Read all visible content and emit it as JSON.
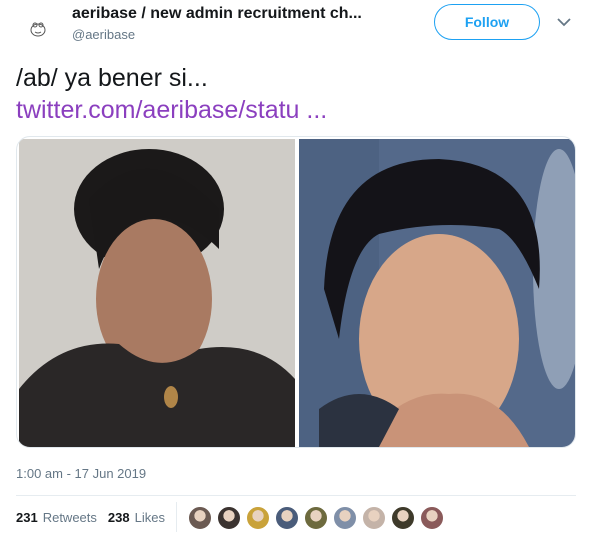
{
  "header": {
    "display_name": "aeribase / new admin recruitment ch...",
    "handle": "@aeribase",
    "follow_label": "Follow",
    "avatar_icon": "frog-doodle-icon",
    "menu_icon": "chevron-down-icon"
  },
  "tweet": {
    "text": "/ab/ ya bener si...",
    "link": "twitter.com/aeribase/statu ...",
    "link_color": "#8b3fbf"
  },
  "media": {
    "photos": [
      {
        "name": "photo-left",
        "icon": "portrait-photo"
      },
      {
        "name": "photo-right",
        "icon": "portrait-photo"
      }
    ]
  },
  "meta": {
    "timestamp": "1:00 am - 17 Jun 2019"
  },
  "stats": {
    "retweets_count": "231",
    "retweets_label": "Retweets",
    "likes_count": "238",
    "likes_label": "Likes"
  },
  "likers": [
    {
      "icon": "user-avatar",
      "color": "#6b5a52"
    },
    {
      "icon": "user-avatar",
      "color": "#3b3330"
    },
    {
      "icon": "user-avatar",
      "color": "#c9a23a"
    },
    {
      "icon": "user-avatar",
      "color": "#4a5c7a"
    },
    {
      "icon": "user-avatar",
      "color": "#6d6a3e"
    },
    {
      "icon": "user-avatar",
      "color": "#7f8fa8"
    },
    {
      "icon": "user-avatar",
      "color": "#c4b3a8"
    },
    {
      "icon": "user-avatar",
      "color": "#3e3a2a"
    },
    {
      "icon": "user-avatar",
      "color": "#8a5a5a"
    }
  ],
  "colors": {
    "accent": "#1da1f2",
    "secondary_text": "#657786",
    "border": "#e1e8ed"
  }
}
